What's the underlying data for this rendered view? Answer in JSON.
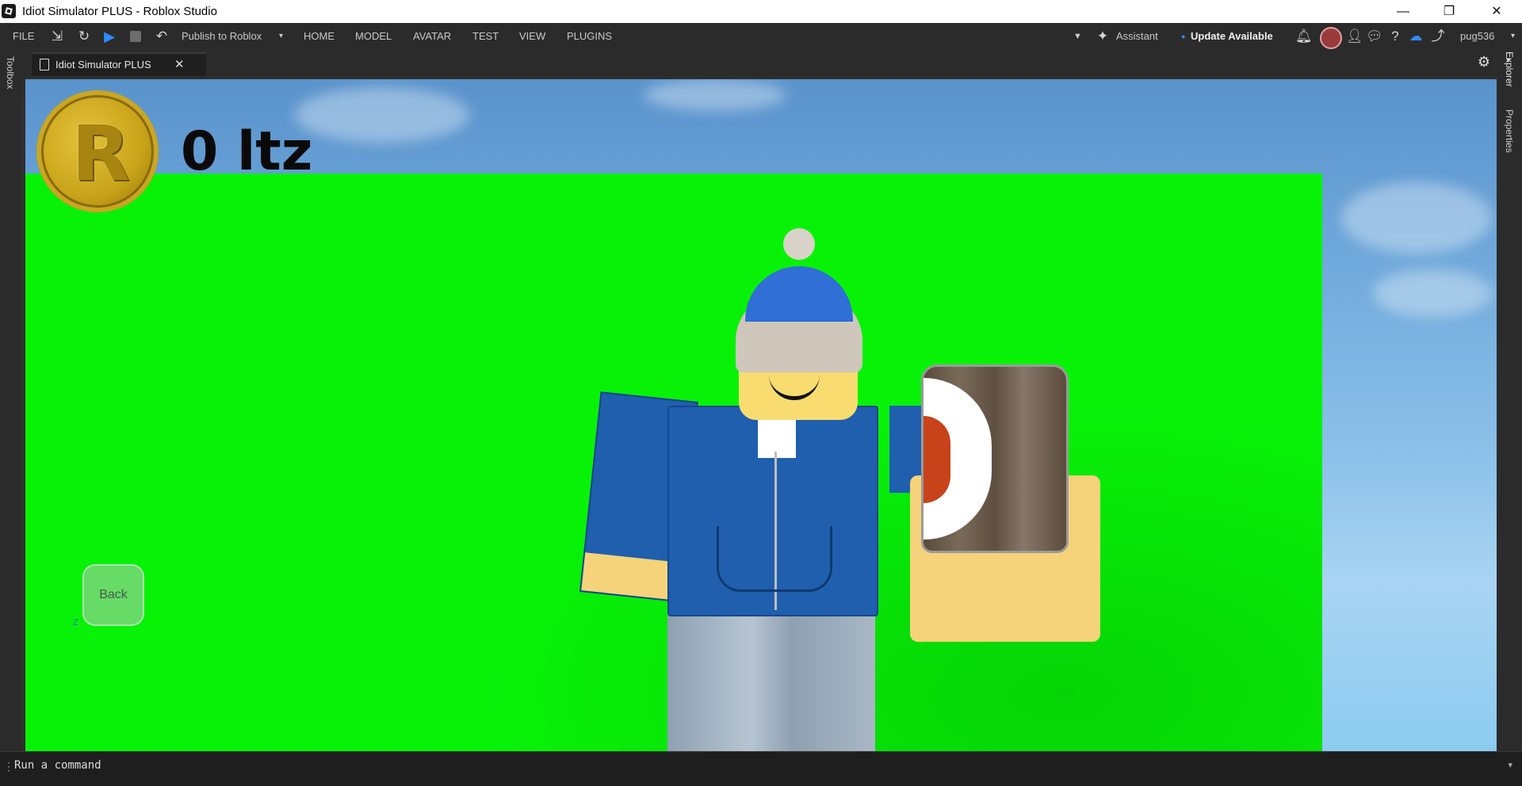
{
  "window": {
    "title": "Idiot Simulator PLUS - Roblox Studio",
    "controls": {
      "minimize": "—",
      "restore": "❐",
      "close": "✕"
    }
  },
  "menubar": {
    "file": "FILE",
    "publish": "Publish to Roblox",
    "tabs": [
      "HOME",
      "MODEL",
      "AVATAR",
      "TEST",
      "VIEW",
      "PLUGINS"
    ],
    "assistant": "Assistant",
    "update": "Update Available",
    "username": "pug536"
  },
  "document_tab": {
    "label": "Idiot Simulator PLUS",
    "close": "✕"
  },
  "side_panels": {
    "left": "Toolbox",
    "right_top": "Explorer",
    "right_bottom": "Properties"
  },
  "game_ui": {
    "coin_letter": "R",
    "counter_text": "0 ltz",
    "back_label": "Back",
    "back_key": "Z"
  },
  "command_bar": {
    "placeholder": "Run a command"
  },
  "colors": {
    "accent": "#2f8cff",
    "board_green": "#08f208",
    "studio_dark": "#2b2b2b"
  }
}
